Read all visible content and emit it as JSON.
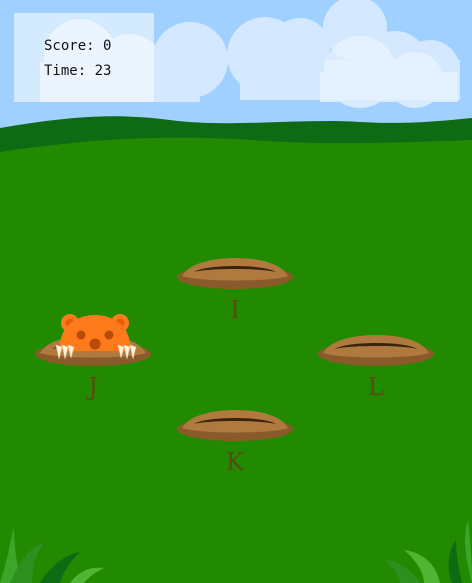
{
  "hud": {
    "score_label": "Score: 0",
    "time_label": "Time: 23",
    "score": 0,
    "time": 23
  },
  "holes": [
    {
      "key": "I",
      "has_mole": false
    },
    {
      "key": "J",
      "has_mole": true
    },
    {
      "key": "L",
      "has_mole": false
    },
    {
      "key": "K",
      "has_mole": false
    }
  ],
  "colors": {
    "sky": "#9fd0ff",
    "cloud": "#d4e9ff",
    "far_hill": "#0f6b13",
    "field": "#218a00",
    "hole_rim": "#a8733a",
    "hole_inner": "#3a2410",
    "mole": "#ff7a1a",
    "grass_tuft": "#4fb533"
  },
  "icons": {
    "mole": "mole-icon",
    "hole": "hole-icon"
  }
}
